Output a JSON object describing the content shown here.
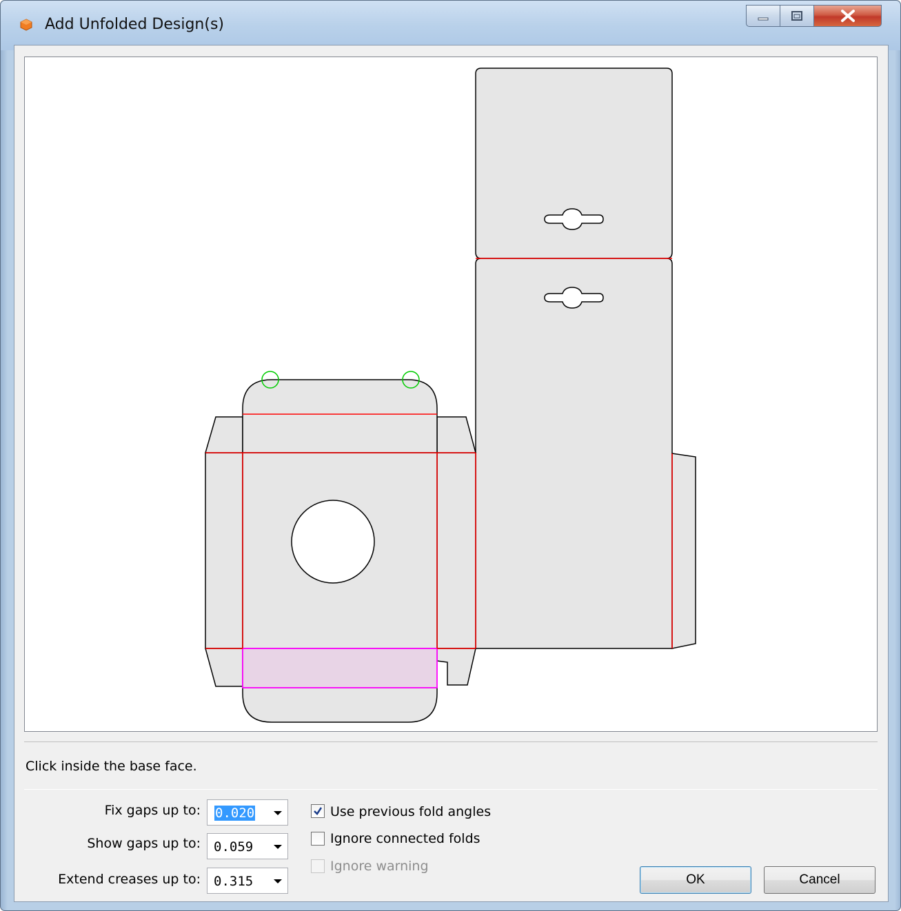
{
  "window": {
    "title": "Add Unfolded Design(s)",
    "controls": [
      "minimize-icon",
      "maximize-icon",
      "close-icon"
    ]
  },
  "status": {
    "message": "Click inside the base face."
  },
  "options": {
    "fix_gaps": {
      "label": "Fix gaps up to:",
      "value": "0.020",
      "selected": true
    },
    "show_gaps": {
      "label": "Show gaps up to:",
      "value": "0.059"
    },
    "extend_creases": {
      "label": "Extend creases up to:",
      "value": "0.315"
    }
  },
  "checkboxes": {
    "use_previous": {
      "label": "Use previous fold angles",
      "checked": true,
      "enabled": true
    },
    "ignore_connected": {
      "label": "Ignore connected folds",
      "checked": false,
      "enabled": true
    },
    "ignore_warning": {
      "label": "Ignore warning",
      "checked": false,
      "enabled": false
    }
  },
  "buttons": {
    "ok": "OK",
    "cancel": "Cancel"
  },
  "colors": {
    "cut_line": "#000000",
    "crease_line": "#ff0000",
    "base_face_highlight": "#ff00ff",
    "gap_marker": "#00cc00",
    "panel_fill": "#e6e6e6"
  }
}
